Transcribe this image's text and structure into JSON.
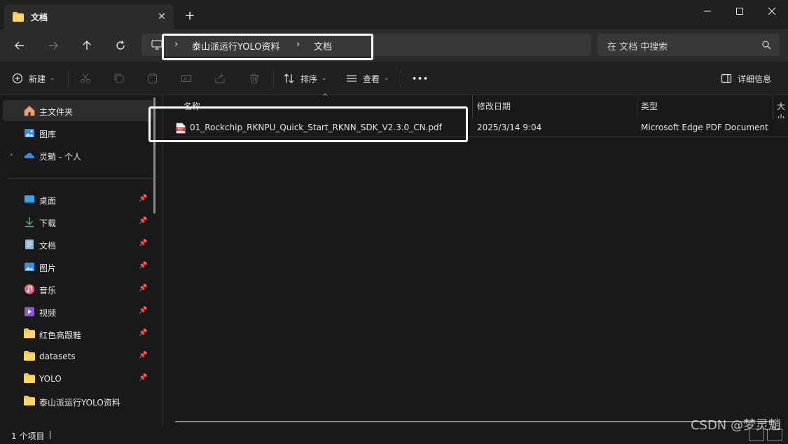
{
  "window": {
    "tab_title": "文档",
    "tab_close": "✕",
    "new_tab": "+",
    "controls": [
      "minimize",
      "maximize",
      "close"
    ]
  },
  "address_bar": {
    "breadcrumbs": [
      "泰山派运行YOLO资料",
      "文档"
    ],
    "search_placeholder": "在 文档 中搜索"
  },
  "toolbar": {
    "new_label": "新建",
    "sort_label": "排序",
    "view_label": "查看",
    "more_label": "•••",
    "details_label": "详细信息"
  },
  "sidebar": {
    "top_items": [
      {
        "label": "主文件夹",
        "icon": "home-icon",
        "selected": true
      },
      {
        "label": "图库",
        "icon": "gallery-icon"
      },
      {
        "label": "灵魈 - 个人",
        "icon": "onedrive-icon",
        "expandable": true
      }
    ],
    "pinned_items": [
      {
        "label": "桌面",
        "icon": "desktop-icon",
        "pinned": true
      },
      {
        "label": "下载",
        "icon": "download-icon",
        "pinned": true
      },
      {
        "label": "文档",
        "icon": "documents-icon",
        "pinned": true
      },
      {
        "label": "图片",
        "icon": "pictures-icon",
        "pinned": true
      },
      {
        "label": "音乐",
        "icon": "music-icon",
        "pinned": true
      },
      {
        "label": "视频",
        "icon": "videos-icon",
        "pinned": true
      },
      {
        "label": "红色高跟鞋",
        "icon": "folder-icon",
        "pinned": true
      },
      {
        "label": "datasets",
        "icon": "folder-icon",
        "pinned": true
      },
      {
        "label": "YOLO",
        "icon": "folder-icon",
        "pinned": true
      },
      {
        "label": "泰山派运行YOLO资料",
        "icon": "folder-icon",
        "pinned": false
      }
    ]
  },
  "file_list": {
    "columns": [
      "名称",
      "修改日期",
      "类型",
      "大小"
    ],
    "sort_indicator": "^",
    "rows": [
      {
        "name": "01_Rockchip_RKNPU_Quick_Start_RKNN_SDK_V2.3.0_CN.pdf",
        "modified": "2025/3/14 9:04",
        "type": "Microsoft Edge PDF Document",
        "icon": "pdf-file-icon"
      }
    ]
  },
  "status_bar": {
    "item_count": "1 个项目"
  },
  "watermark": "CSDN @梦灵魈",
  "colors": {
    "accent_highlight": "#ffffff",
    "folder": "#f4c542",
    "pdf_red": "#d13438"
  }
}
